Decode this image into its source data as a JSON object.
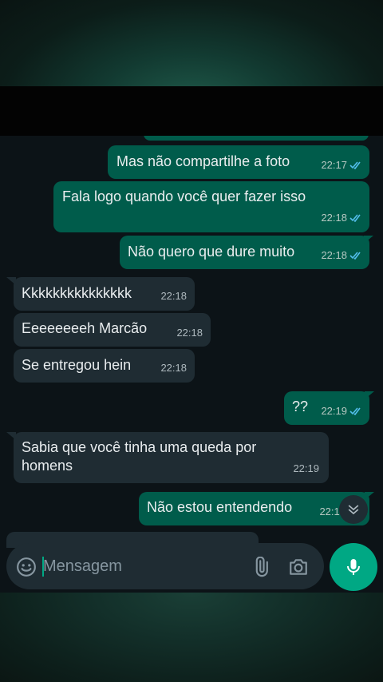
{
  "messages": [
    {
      "dir": "out",
      "text": "Mas não compartilhe a foto",
      "time": "22:17",
      "read": true
    },
    {
      "dir": "out",
      "text": "Fala logo quando você quer fazer isso",
      "time": "22:18",
      "read": true
    },
    {
      "dir": "out",
      "text": "Não quero que dure muito",
      "time": "22:18",
      "read": true
    },
    {
      "dir": "in",
      "text": "Kkkkkkkkkkkkkkk",
      "time": "22:18"
    },
    {
      "dir": "in",
      "text": "Eeeeeeeeh Marcão",
      "time": "22:18"
    },
    {
      "dir": "in",
      "text": "Se entregou hein",
      "time": "22:18"
    },
    {
      "dir": "out",
      "text": "??",
      "time": "22:19",
      "read": true
    },
    {
      "dir": "in",
      "text_line1": "Sabia que você tinha uma queda por",
      "text_line2": "homens",
      "time": "22:19"
    },
    {
      "dir": "out",
      "text": "Não estou entendendo",
      "time": "22:19"
    }
  ],
  "composer": {
    "placeholder": "Mensagem",
    "emoji_icon": "emoji-icon",
    "attach_icon": "paperclip-icon",
    "camera_icon": "camera-icon",
    "mic_icon": "microphone-icon"
  },
  "colors": {
    "outgoing_bubble": "#005c4b",
    "incoming_bubble": "#1f2c33",
    "chat_background": "#0c1317",
    "accent": "#00a884",
    "read_tick": "#53bdeb"
  }
}
